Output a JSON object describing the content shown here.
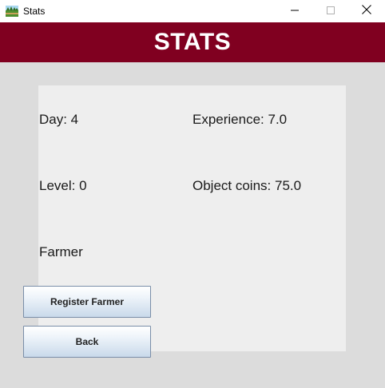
{
  "window": {
    "title": "Stats",
    "icon": "farm-field-icon",
    "controls": [
      "minimize-icon",
      "maximize-icon",
      "close-icon"
    ]
  },
  "header": {
    "title": "STATS",
    "background_color": "#800020",
    "text_color": "#ffffff"
  },
  "stats": {
    "day": "Day: 4",
    "experience": "Experience: 7.0",
    "level": "Level: 0",
    "object_coins": "Object coins: 75.0",
    "role": "Farmer"
  },
  "buttons": {
    "register": "Register Farmer",
    "back": "Back"
  }
}
